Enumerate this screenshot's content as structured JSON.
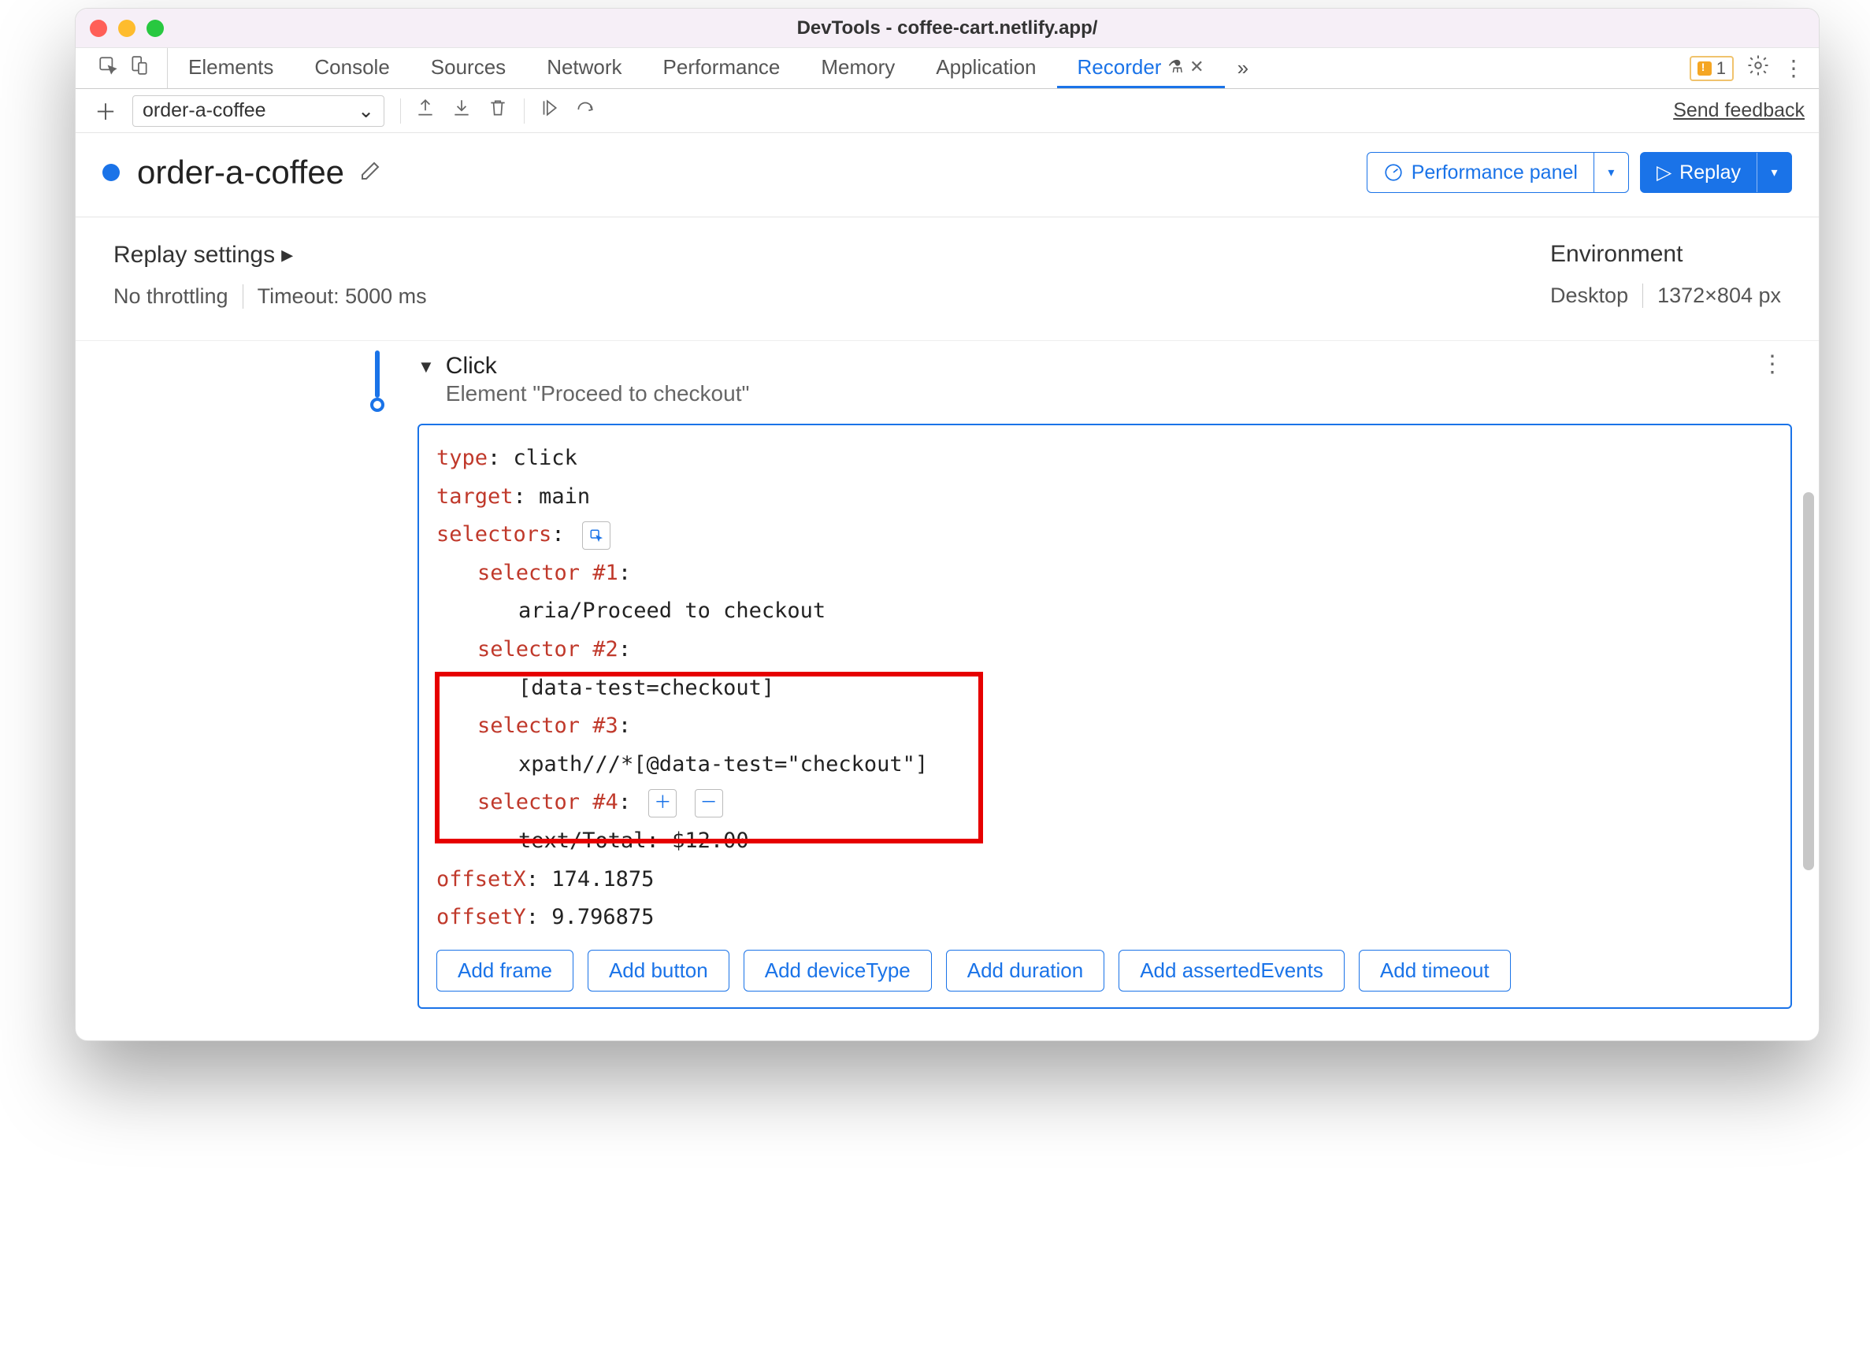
{
  "window": {
    "title": "DevTools - coffee-cart.netlify.app/"
  },
  "tabs": {
    "items": [
      "Elements",
      "Console",
      "Sources",
      "Network",
      "Performance",
      "Memory",
      "Application",
      "Recorder"
    ],
    "active": "Recorder",
    "issues_count": "1"
  },
  "secbar": {
    "recording_name": "order-a-coffee",
    "feedback": "Send feedback"
  },
  "header": {
    "title": "order-a-coffee",
    "perf_button": "Performance panel",
    "replay_button": "Replay"
  },
  "settings": {
    "replay_heading": "Replay settings",
    "throttling": "No throttling",
    "timeout": "Timeout: 5000 ms",
    "env_heading": "Environment",
    "env_device": "Desktop",
    "env_dims": "1372×804 px"
  },
  "step": {
    "title": "Click",
    "subtitle": "Element \"Proceed to checkout\"",
    "type_key": "type",
    "type_val": ": click",
    "target_key": "target",
    "target_val": ": main",
    "selectors_key": "selectors",
    "selectors_colon": ":",
    "sel1_key": "selector #1",
    "sel1_val": "aria/Proceed to checkout",
    "sel2_key": "selector #2",
    "sel2_val": "[data-test=checkout]",
    "sel3_key": "selector #3",
    "sel3_val": "xpath///*[@data-test=\"checkout\"]",
    "sel4_key": "selector #4",
    "sel4_val": "text/Total: $12.00",
    "offx_key": "offsetX",
    "offx_val": ": 174.1875",
    "offy_key": "offsetY",
    "offy_val": ": 9.796875",
    "addbtns": [
      "Add frame",
      "Add button",
      "Add deviceType",
      "Add duration",
      "Add assertedEvents",
      "Add timeout"
    ]
  }
}
